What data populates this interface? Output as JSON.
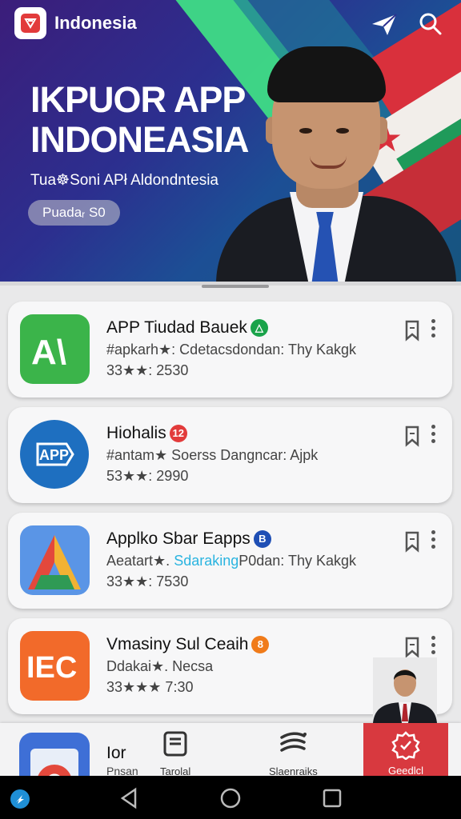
{
  "header": {
    "brand": "Indonesia",
    "icons": {
      "logo": "app-logo-icon",
      "send": "paper-plane-icon",
      "search": "search-icon"
    }
  },
  "hero": {
    "title_line1": "IKPUOR APP",
    "title_line2": "INDONEASIA",
    "subtitle": "Tua☸Soni APł Aldondntesia",
    "pill": "Puadaᵣ S0"
  },
  "apps": [
    {
      "title": "APP Tiudad Bauek",
      "badge": "△",
      "badge_color": "#1aa34a",
      "subtitle": "#apkarh★: Cdetacsdondan: Thy Kakgk",
      "meta": "33★★: 2530",
      "icon_text": "A\\",
      "icon_color": "#3bb44a"
    },
    {
      "title": "Hiohalis",
      "badge": "12",
      "badge_color": "#e23b3b",
      "subtitle": "#antam★ Soerss Dangncar: Ajpk",
      "meta": "53★★: 2990",
      "icon_text": "APP",
      "icon_color": "#1e6fc0"
    },
    {
      "title": "Applko Sbar Eapps",
      "badge": "B",
      "badge_color": "#1f4fb5",
      "subtitle_pre": "Aeatart★. ",
      "subtitle_hl": "Sdaraking",
      "subtitle_post": "P0dan: Thy Kakgk",
      "meta": "33★★: 7530",
      "icon_color": "#4f8fe0"
    },
    {
      "title": "Vmasiny Sul Ceaih",
      "badge": "8",
      "badge_color": "#f07b1a",
      "subtitle": "Ddakai★. Necsa",
      "meta": "33★★★ 7:30",
      "icon_text": "IEC",
      "icon_color": "#f26a2a"
    }
  ],
  "bottom_nav": {
    "app_title": "Ior",
    "app_sub": "Pnsan",
    "items": [
      {
        "label": "Tarolal",
        "icon": "tablet-icon"
      },
      {
        "label": "Slaenraiks",
        "icon": "layers-icon"
      },
      {
        "label": "Geedlcl",
        "icon": "badge-seal-icon",
        "active": true
      }
    ]
  },
  "colors": {
    "accent_red": "#d8393f",
    "hero_purple": "#3b1d7a",
    "hero_green": "#3fdc86"
  }
}
